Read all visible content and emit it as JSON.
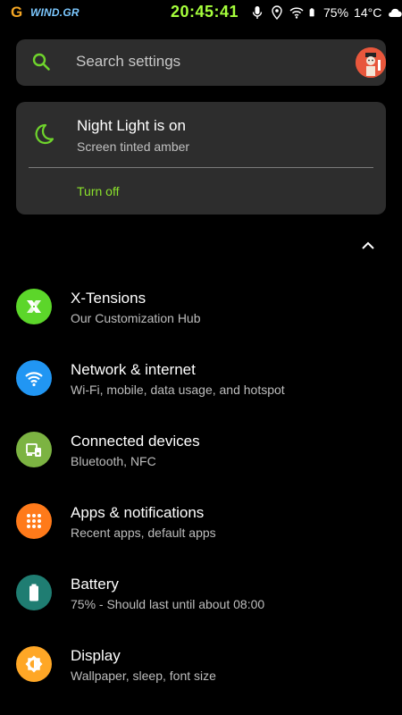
{
  "status_bar": {
    "carrier_logo": "G",
    "carrier": "WIND.GR",
    "time": "20:45:41",
    "battery": "75%",
    "temperature": "14°C"
  },
  "search": {
    "placeholder": "Search settings"
  },
  "night_light": {
    "title": "Night Light is on",
    "subtitle": "Screen tinted amber",
    "action": "Turn off"
  },
  "items": [
    {
      "title": "X-Tensions",
      "subtitle": "Our Customization Hub",
      "icon": "x-tensions-icon",
      "color": "#5cd62a"
    },
    {
      "title": "Network & internet",
      "subtitle": "Wi-Fi, mobile, data usage, and hotspot",
      "icon": "wifi-icon",
      "color": "#2196f3"
    },
    {
      "title": "Connected devices",
      "subtitle": "Bluetooth, NFC",
      "icon": "devices-icon",
      "color": "#7cb342"
    },
    {
      "title": "Apps & notifications",
      "subtitle": "Recent apps, default apps",
      "icon": "apps-grid-icon",
      "color": "#ff7a1a"
    },
    {
      "title": "Battery",
      "subtitle": "75% - Should last until about 08:00",
      "icon": "battery-icon",
      "color": "#1f7d72"
    },
    {
      "title": "Display",
      "subtitle": "Wallpaper, sleep, font size",
      "icon": "brightness-icon",
      "color": "#ffa726"
    }
  ],
  "colors": {
    "accent": "#8be22c",
    "surface": "#2d2d2d",
    "clock": "#a6ff3c"
  }
}
